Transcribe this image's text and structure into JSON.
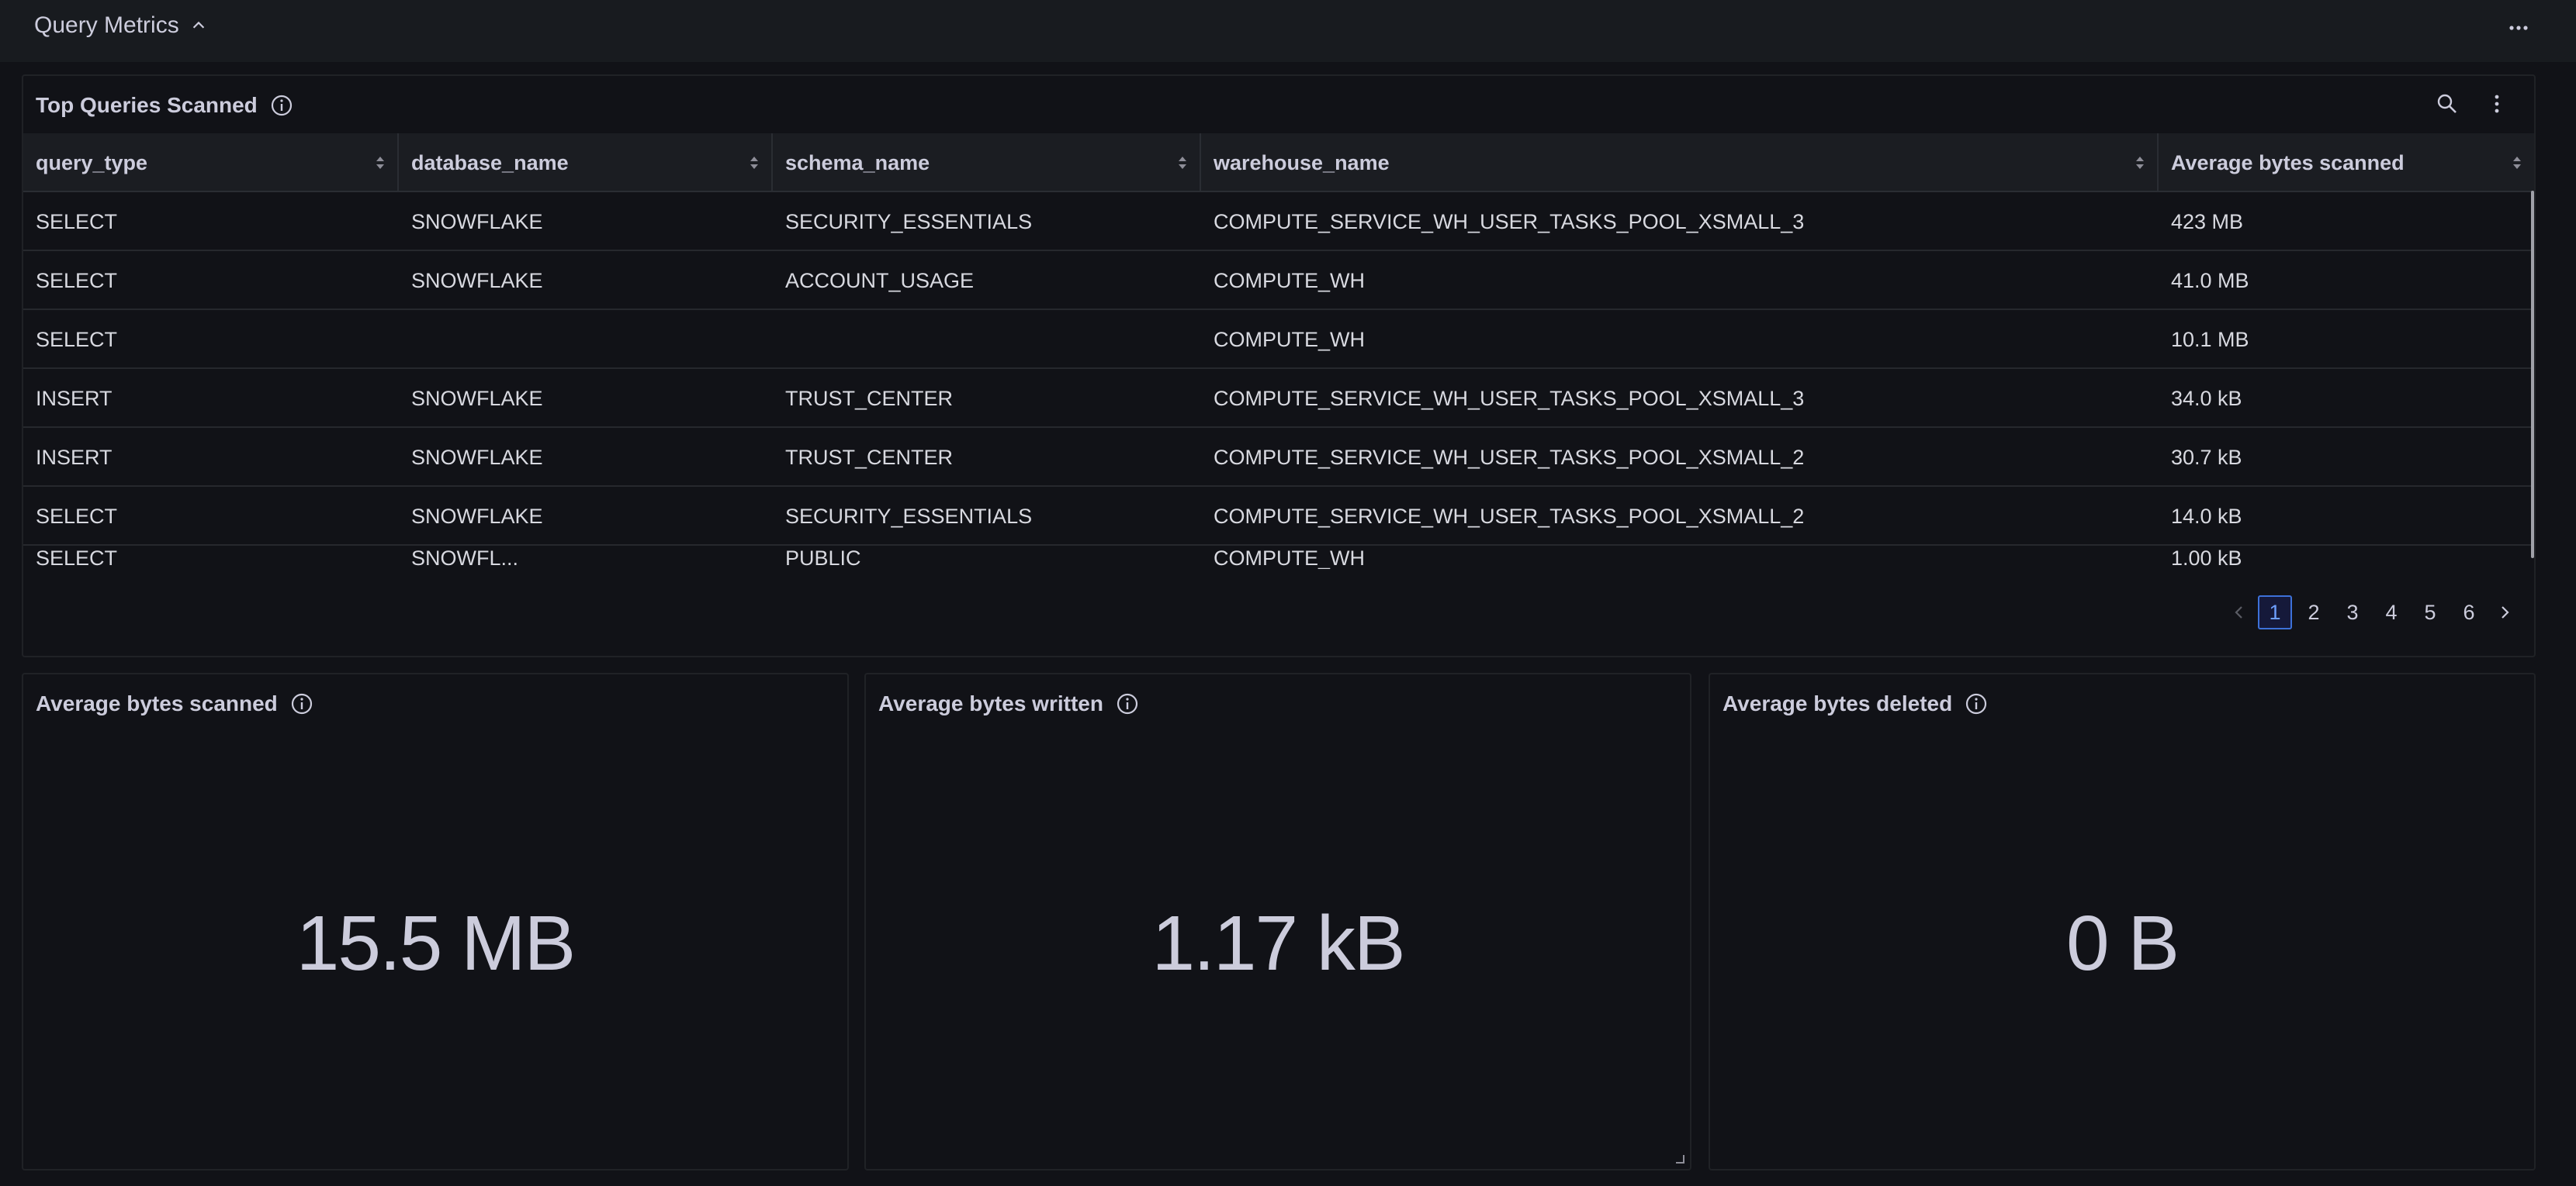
{
  "section": {
    "title": "Query Metrics",
    "collapse_icon": "chevron-up-icon",
    "menu_icon": "ellipsis-horizontal-icon"
  },
  "table_panel": {
    "title": "Top Queries Scanned",
    "columns": [
      "query_type",
      "database_name",
      "schema_name",
      "warehouse_name",
      "Average bytes scanned"
    ],
    "rows": [
      [
        "SELECT",
        "SNOWFLAKE",
        "SECURITY_ESSENTIALS",
        "COMPUTE_SERVICE_WH_USER_TASKS_POOL_XSMALL_3",
        "423 MB"
      ],
      [
        "SELECT",
        "SNOWFLAKE",
        "ACCOUNT_USAGE",
        "COMPUTE_WH",
        "41.0 MB"
      ],
      [
        "SELECT",
        "",
        "",
        "COMPUTE_WH",
        "10.1 MB"
      ],
      [
        "INSERT",
        "SNOWFLAKE",
        "TRUST_CENTER",
        "COMPUTE_SERVICE_WH_USER_TASKS_POOL_XSMALL_3",
        "34.0 kB"
      ],
      [
        "INSERT",
        "SNOWFLAKE",
        "TRUST_CENTER",
        "COMPUTE_SERVICE_WH_USER_TASKS_POOL_XSMALL_2",
        "30.7 kB"
      ],
      [
        "SELECT",
        "SNOWFLAKE",
        "SECURITY_ESSENTIALS",
        "COMPUTE_SERVICE_WH_USER_TASKS_POOL_XSMALL_2",
        "14.0 kB"
      ],
      [
        "SELECT",
        "SNOWFL...",
        "PUBLIC",
        "COMPUTE_WH",
        "1.00 kB"
      ]
    ],
    "pagination": {
      "pages": [
        "1",
        "2",
        "3",
        "4",
        "5",
        "6"
      ],
      "current": "1"
    }
  },
  "stats": {
    "scanned": {
      "title": "Average bytes scanned",
      "value": "15.5 MB"
    },
    "written": {
      "title": "Average bytes written",
      "value": "1.17 kB"
    },
    "deleted": {
      "title": "Average bytes deleted",
      "value": "0 B"
    }
  },
  "colors": {
    "background": "#111217",
    "accent": "#3d71d9",
    "text": "#ccccdc"
  }
}
